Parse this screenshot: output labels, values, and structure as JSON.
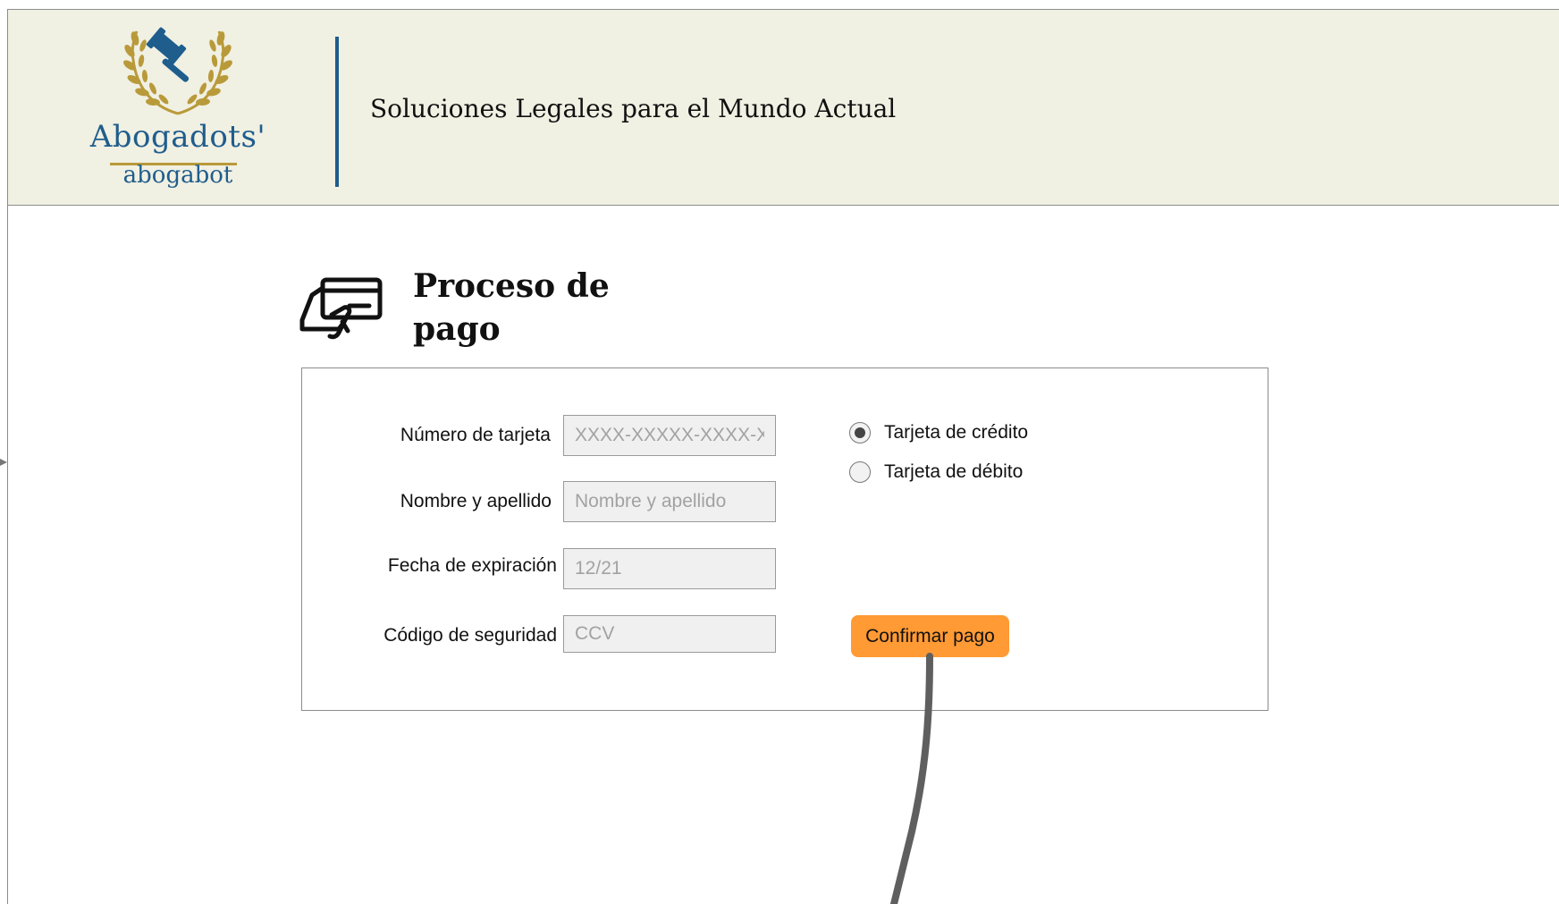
{
  "header": {
    "logo_name": "Abogadots'",
    "logo_sub": "abogabot",
    "tagline": "Soluciones Legales para el Mundo Actual"
  },
  "page": {
    "title": "Proceso de pago"
  },
  "form": {
    "card_number": {
      "label": "Número de tarjeta",
      "placeholder": "XXXX-XXXXX-XXXX-XXXX",
      "value": ""
    },
    "full_name": {
      "label": "Nombre y apellido",
      "placeholder": "Nombre y apellido",
      "value": ""
    },
    "expiry": {
      "label": "Fecha de expiración",
      "placeholder": "12/21",
      "value": ""
    },
    "cvv": {
      "label": "Código de seguridad",
      "placeholder": "CCV",
      "value": ""
    },
    "card_type": {
      "options": [
        {
          "label": "Tarjeta de crédito",
          "selected": true
        },
        {
          "label": "Tarjeta de débito",
          "selected": false
        }
      ]
    },
    "confirm_label": "Confirmar pago"
  },
  "colors": {
    "header_bg": "#f0f0e3",
    "brand_blue": "#1f5d8c",
    "brand_gold": "#b99a3a",
    "button_orange": "#ff9a35",
    "input_bg": "#f0f0f0"
  },
  "icons": {
    "logo": "gavel-laurel-icon",
    "title": "card-payment-icon"
  }
}
